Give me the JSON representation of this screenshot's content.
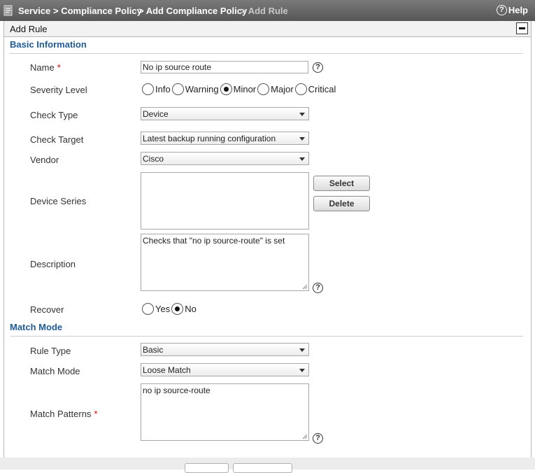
{
  "breadcrumb": {
    "items": [
      "Service",
      "> Compliance Policy",
      "> Add Compliance Policy",
      "> Add Rule"
    ],
    "help_label": "Help",
    "help_glyph": "?"
  },
  "panel": {
    "title": "Add Rule"
  },
  "basic": {
    "section_title": "Basic Information",
    "name": {
      "label": "Name",
      "required_mark": "*",
      "value": "No ip source route"
    },
    "severity": {
      "label": "Severity Level",
      "options": [
        "Info",
        "Warning",
        "Minor",
        "Major",
        "Critical"
      ],
      "selected": "Minor"
    },
    "check_type": {
      "label": "Check Type",
      "value": "Device"
    },
    "check_target": {
      "label": "Check Target",
      "value": "Latest backup running configuration"
    },
    "vendor": {
      "label": "Vendor",
      "value": "Cisco"
    },
    "device_series": {
      "label": "Device Series",
      "select_label": "Select",
      "delete_label": "Delete"
    },
    "description": {
      "label": "Description",
      "value": "Checks that \"no ip source-route\" is set"
    },
    "recover": {
      "label": "Recover",
      "options": [
        "Yes",
        "No"
      ],
      "selected": "No"
    }
  },
  "match": {
    "section_title": "Match Mode",
    "rule_type": {
      "label": "Rule Type",
      "value": "Basic"
    },
    "match_mode": {
      "label": "Match Mode",
      "value": "Loose Match"
    },
    "patterns": {
      "label": "Match Patterns",
      "required_mark": "*",
      "value": "no ip source-route"
    }
  },
  "icons": {
    "home": "document-home-icon",
    "help": "question-circle-icon",
    "collapse": "minus-box-icon",
    "dropdown": "chevron-down-icon",
    "resize": "resize-grip-icon"
  },
  "colors": {
    "toolbar": "#666666",
    "section_title": "#1f5a9a",
    "required": "#dd0000",
    "crumb_current": "#c8c8c8"
  }
}
